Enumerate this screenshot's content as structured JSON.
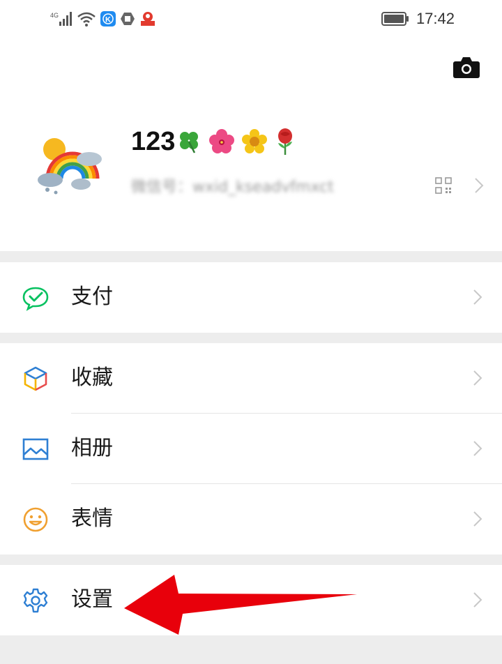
{
  "status_bar": {
    "network": "4G",
    "time": "17:42",
    "icons": [
      "signal-icon",
      "wifi-icon",
      "k-app-icon",
      "shield-icon",
      "notification-app-icon",
      "battery-icon"
    ]
  },
  "profile": {
    "nickname": "123",
    "nickname_emoji": [
      "🍀",
      "🌺",
      "🌼",
      "🌹"
    ],
    "wechat_id_blurred": "微信号：wxid_kseadvfmxct",
    "icons": [
      "camera-icon",
      "avatar",
      "qr-code-icon",
      "chevron-right-icon"
    ]
  },
  "menu": {
    "payment": {
      "label": "支付",
      "icon": "wechat-pay-icon",
      "icon_color": "#07c160"
    },
    "favorites": {
      "label": "收藏",
      "icon": "favorites-cube-icon"
    },
    "album": {
      "label": "相册",
      "icon": "album-icon",
      "icon_color": "#2e7fd3"
    },
    "stickers": {
      "label": "表情",
      "icon": "smiley-icon",
      "icon_color": "#f0a030"
    },
    "settings": {
      "label": "设置",
      "icon": "gear-icon",
      "icon_color": "#2e7fd3"
    }
  },
  "colors": {
    "background": "#ededed",
    "card": "#ffffff",
    "chevron": "#c8c8c8",
    "annotation_arrow": "#e8000b"
  }
}
